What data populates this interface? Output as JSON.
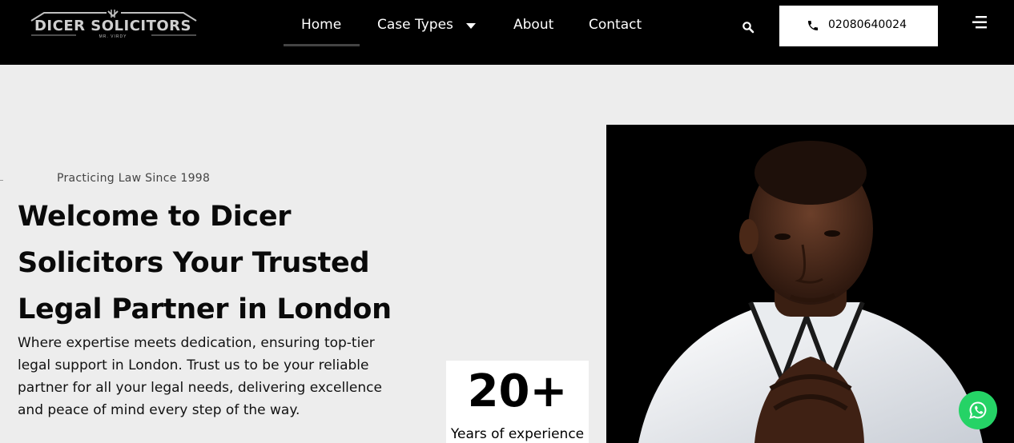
{
  "logo": {
    "name": "DICER SOLICITORS",
    "tagline": "MR. VIRDY"
  },
  "nav": {
    "items": [
      {
        "label": "Home",
        "active": true
      },
      {
        "label": "Case Types",
        "has_dropdown": true
      },
      {
        "label": "About"
      },
      {
        "label": "Contact"
      }
    ]
  },
  "header": {
    "search_icon": "search-icon",
    "phone": "02080640024",
    "phone_icon": "phone-icon",
    "menu_icon": "hamburger-menu-icon"
  },
  "hero": {
    "eyebrow": "Practicing Law Since 1998",
    "title_line1": "Welcome to Dicer",
    "title_line2": "Solicitors Your Trusted",
    "title_line3": "Legal Partner in London",
    "description": "Where expertise meets dedication, ensuring top-tier legal support in London. Trust us to be your reliable partner for all your legal needs, delivering excellence and peace of mind every step of the way."
  },
  "stat": {
    "value": "20+",
    "label": "Years of experience"
  },
  "floating": {
    "whatsapp_icon": "whatsapp-icon"
  },
  "colors": {
    "header_bg": "#000000",
    "page_bg": "#ededed",
    "whatsapp": "#25d366"
  }
}
